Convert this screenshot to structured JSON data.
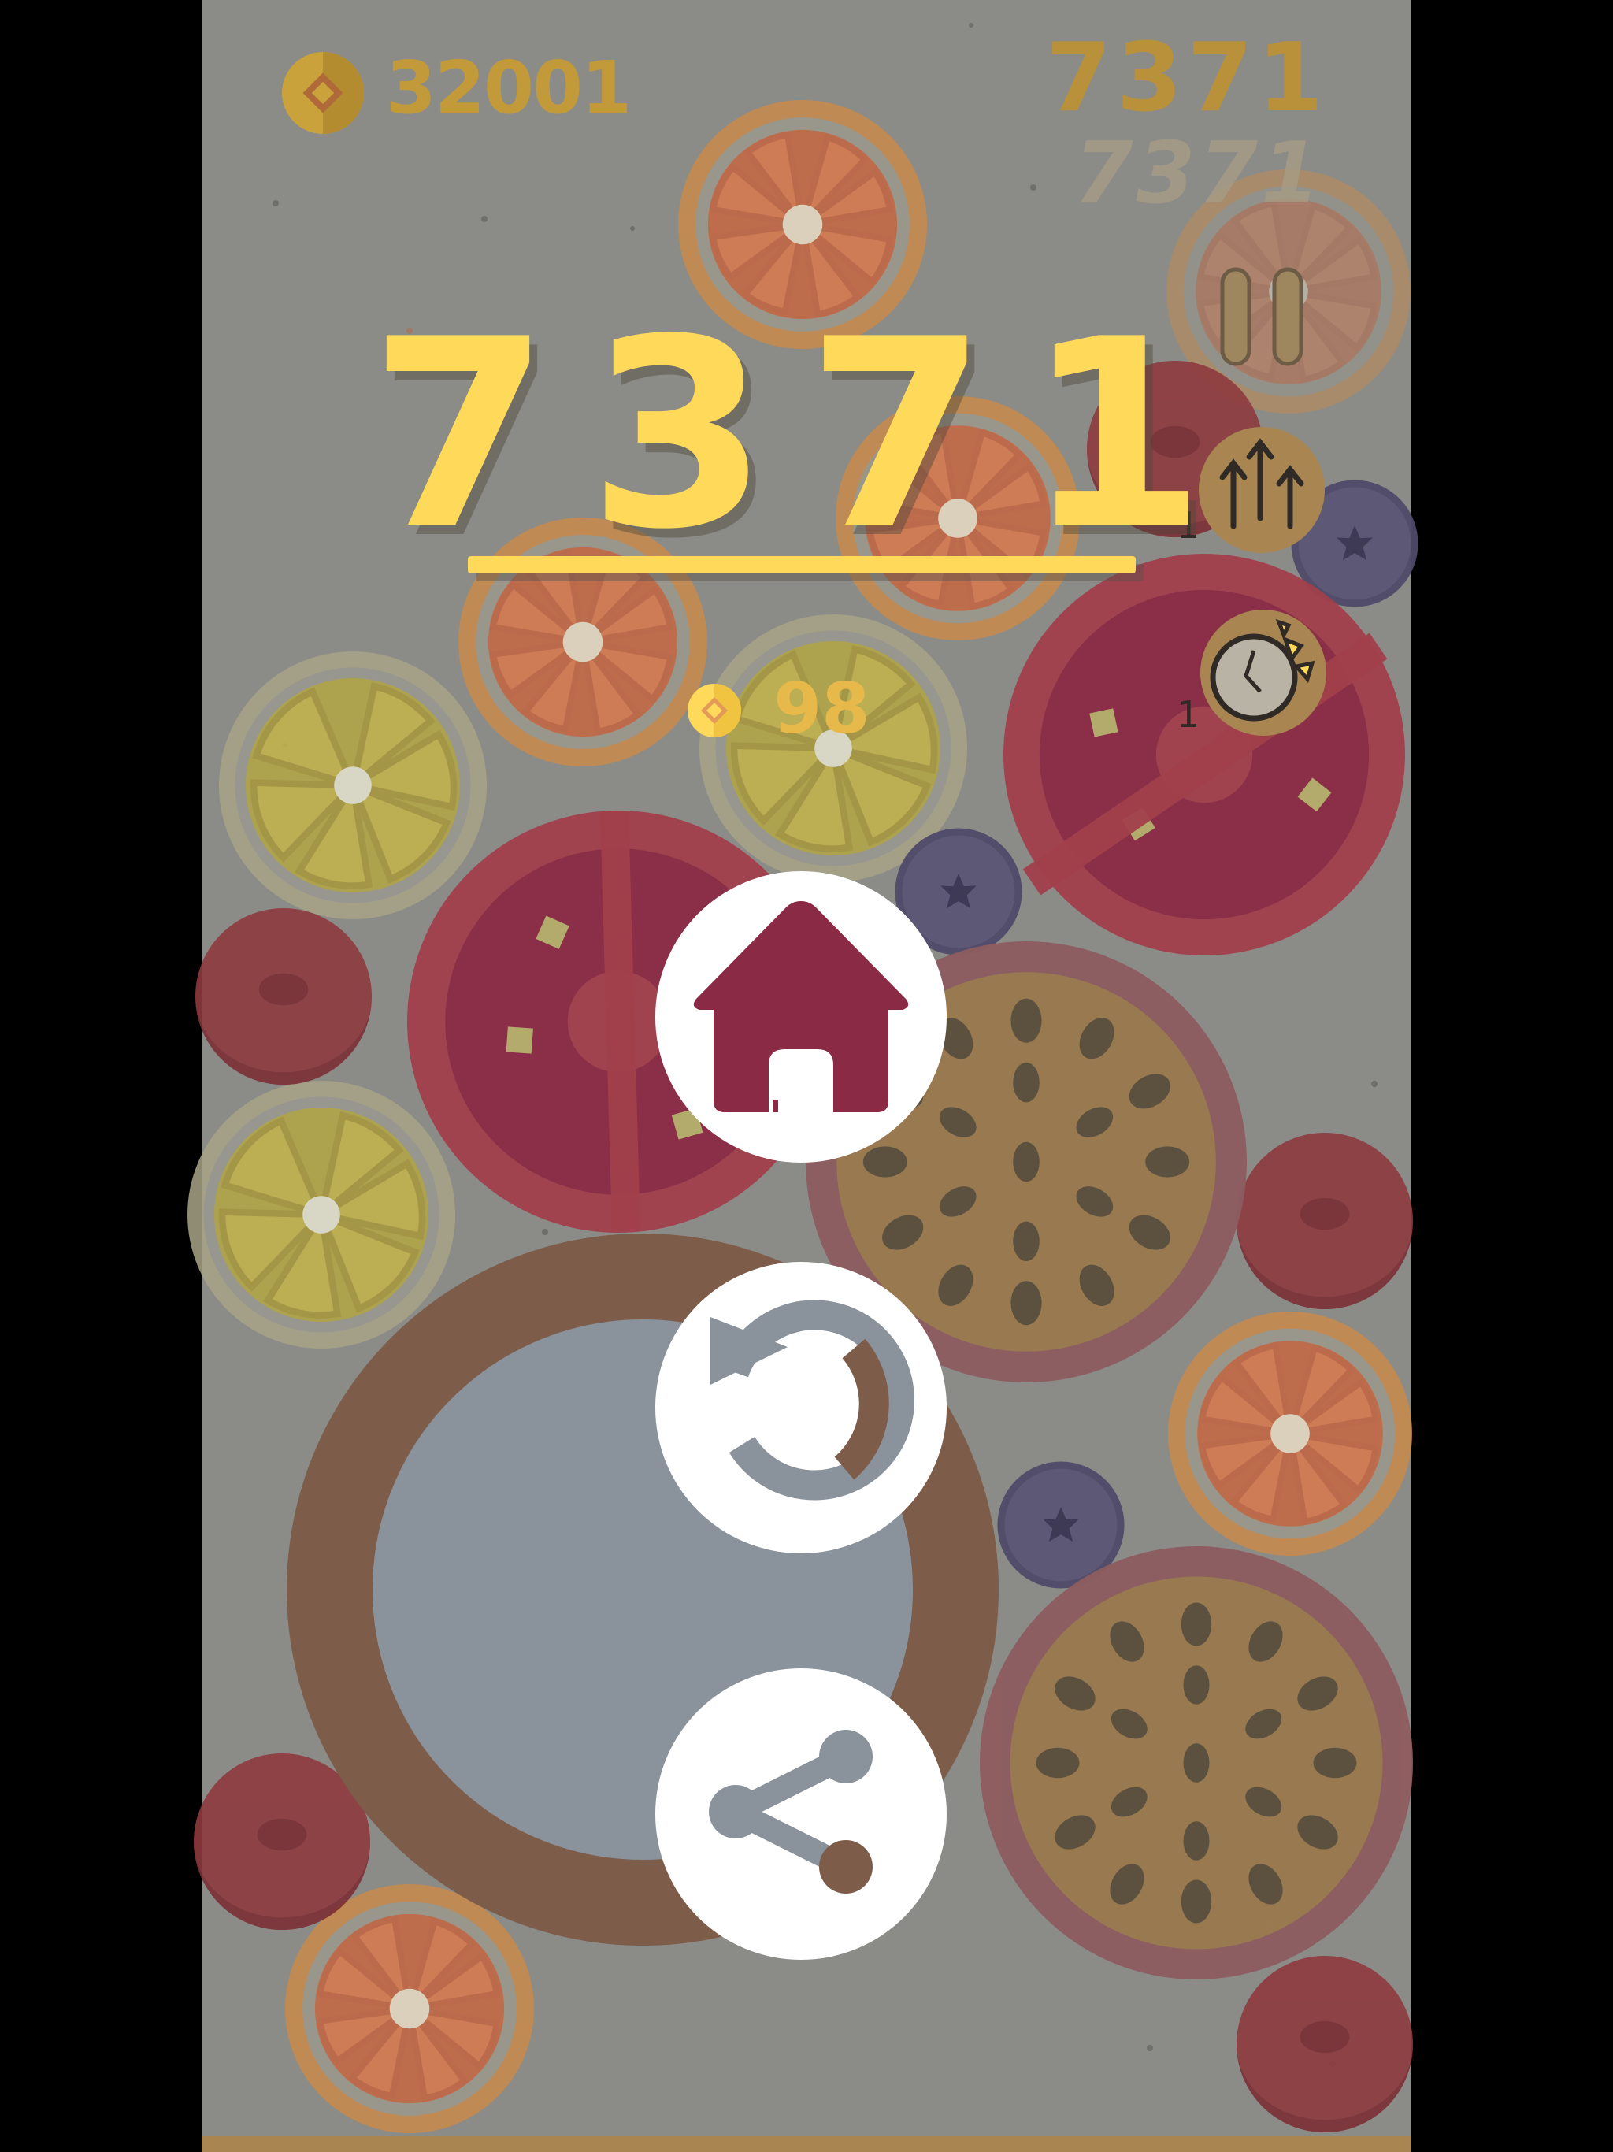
{
  "hud": {
    "coins": "32001",
    "best_score": "7371",
    "current_score": "7371"
  },
  "game_over": {
    "final_score": "7371",
    "coins_earned": "98",
    "buttons": [
      {
        "name": "home",
        "icon": "home-icon"
      },
      {
        "name": "restart",
        "icon": "restart-icon"
      },
      {
        "name": "share",
        "icon": "share-icon"
      }
    ]
  },
  "powerups": [
    {
      "name": "boost",
      "icon": "triple-arrow-up-icon",
      "count": "1"
    },
    {
      "name": "smash",
      "icon": "cracked-clock-icon",
      "count": "1"
    }
  ],
  "colors": {
    "score_yellow": "#ffd95a",
    "coin_gold": "#e7b84a",
    "overlay": "#8b8c87"
  }
}
